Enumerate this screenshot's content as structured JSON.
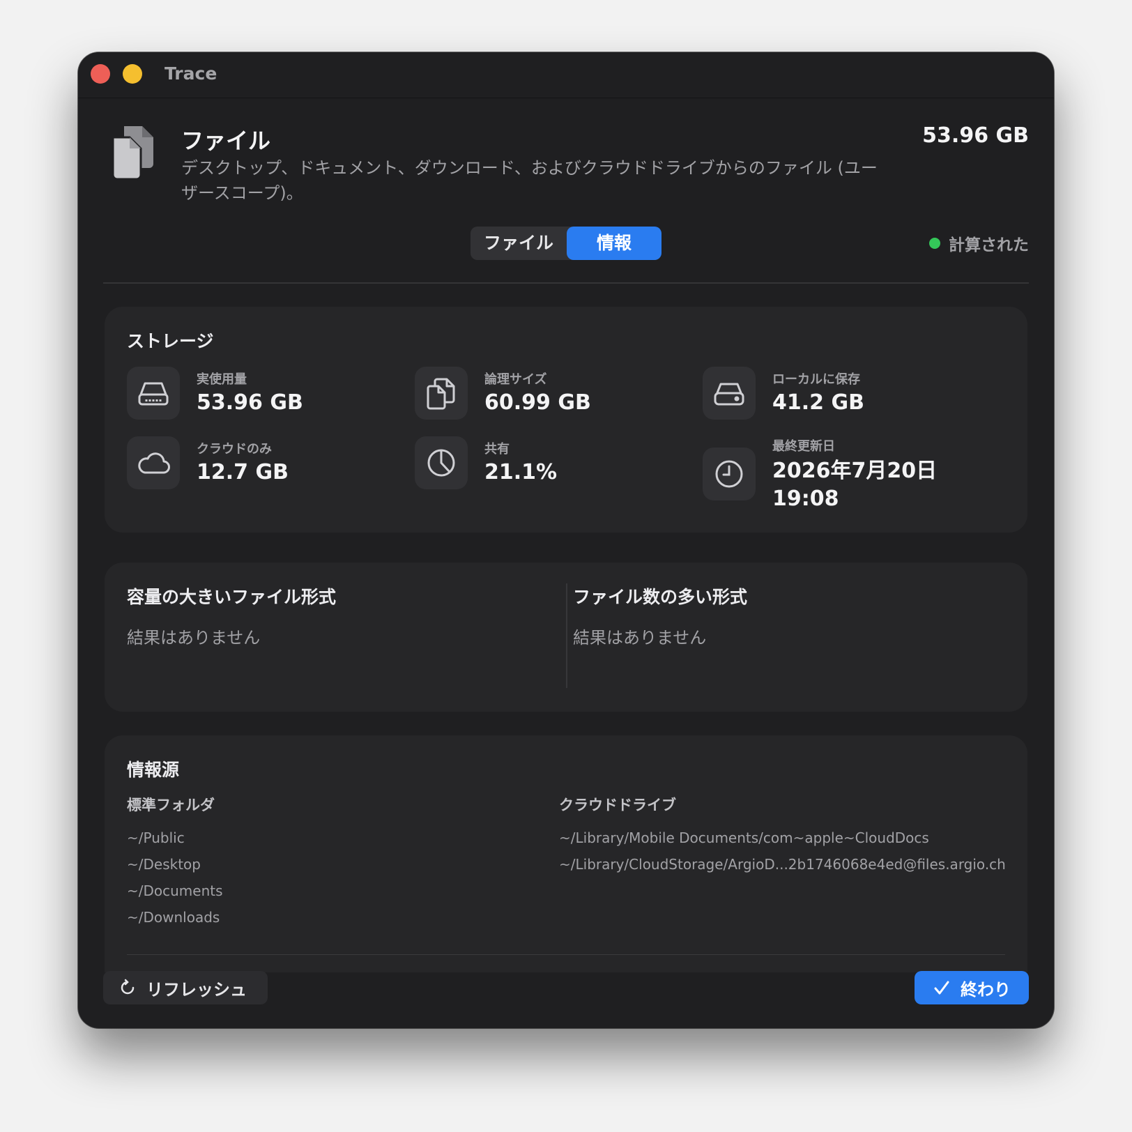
{
  "window": {
    "title": "Trace"
  },
  "header": {
    "title": "ファイル",
    "description": "デスクトップ、ドキュメント、ダウンロード、およびクラウドドライブからのファイル (ユーザースコープ)。",
    "total_size": "53.96 GB",
    "icon": "documents-icon"
  },
  "tabs": {
    "files": "ファイル",
    "info": "情報",
    "selected": "info"
  },
  "status": {
    "label": "計算された",
    "color": "#34c759"
  },
  "storage": {
    "title": "ストレージ",
    "items": [
      {
        "icon": "drive-icon",
        "label": "実使用量",
        "value": "53.96 GB"
      },
      {
        "icon": "documents-icon",
        "label": "論理サイズ",
        "value": "60.99 GB"
      },
      {
        "icon": "internal-drive-icon",
        "label": "ローカルに保存",
        "value": "41.2 GB"
      },
      {
        "icon": "cloud-icon",
        "label": "クラウドのみ",
        "value": "12.7 GB"
      },
      {
        "icon": "pie-chart-icon",
        "label": "共有",
        "value": "21.1%"
      },
      {
        "icon": "clock-icon",
        "label": "最終更新日",
        "value": "2026年7月20日 19:08"
      }
    ]
  },
  "formats": {
    "large": {
      "title": "容量の大きいファイル形式",
      "empty": "結果はありません"
    },
    "many": {
      "title": "ファイル数の多い形式",
      "empty": "結果はありません"
    }
  },
  "sources": {
    "title": "情報源",
    "standard": {
      "heading": "標準フォルダ",
      "paths": [
        "~/Public",
        "~/Desktop",
        "~/Documents",
        "~/Downloads"
      ]
    },
    "cloud": {
      "heading": "クラウドドライブ",
      "paths": [
        "~/Library/Mobile Documents/com~apple~CloudDocs",
        "~/Library/CloudStorage/ArgioD...2b1746068e4ed@files.argio.ch"
      ]
    }
  },
  "footer": {
    "refresh_label": "リフレッシュ",
    "done_label": "終わり"
  },
  "colors": {
    "accent": "#2a7cf0",
    "background": "#1f1f21",
    "card": "#262628"
  }
}
